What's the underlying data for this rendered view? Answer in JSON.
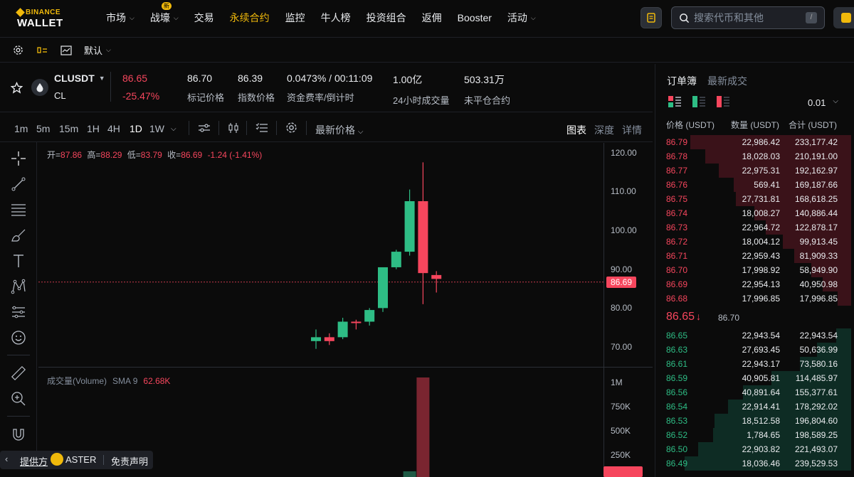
{
  "brand": {
    "top": "BINANCE",
    "bottom": "WALLET"
  },
  "nav": {
    "items": [
      {
        "label": "市场",
        "dropdown": true
      },
      {
        "label": "战壕",
        "dropdown": true,
        "badge": "新"
      },
      {
        "label": "交易"
      },
      {
        "label": "永续合约",
        "active": true
      },
      {
        "label": "监控"
      },
      {
        "label": "牛人榜"
      },
      {
        "label": "投资组合"
      },
      {
        "label": "返佣"
      },
      {
        "label": "Booster"
      },
      {
        "label": "活动",
        "dropdown": true
      }
    ],
    "search_placeholder": "搜索代币和其他",
    "search_shortcut": "/"
  },
  "subbar": {
    "layout_label": "默认"
  },
  "ticker": {
    "symbol": "CLUSDT",
    "sub": "CL",
    "price": "86.65",
    "change": "-25.47%",
    "stats": [
      {
        "value": "86.70",
        "label": "标记价格"
      },
      {
        "value": "86.39",
        "label": "指数价格"
      },
      {
        "value": "0.0473% / 00:11:09",
        "label": "资金费率/倒计时"
      },
      {
        "value": "1.00亿",
        "label": "24小时成交量"
      },
      {
        "value": "503.31万",
        "label": "未平仓合约"
      }
    ]
  },
  "chart_toolbar": {
    "timeframes": [
      "1m",
      "5m",
      "15m",
      "1H",
      "4H",
      "1D",
      "1W"
    ],
    "active_tf": "1D",
    "price_type": "最新价格",
    "tabs": [
      "图表",
      "深度",
      "详情"
    ]
  },
  "ohlc": {
    "open_k": "开=",
    "open": "87.86",
    "high_k": "高=",
    "high": "88.29",
    "low_k": "低=",
    "low": "83.79",
    "close_k": "收=",
    "close": "86.69",
    "change": "-1.24 (-1.41%)"
  },
  "volume": {
    "label": "成交量(Volume)",
    "sma": "SMA 9",
    "value": "62.68K"
  },
  "chart_data": {
    "type": "candlestick",
    "y_ticks": [
      "120.00",
      "110.00",
      "100.00",
      "90.00",
      "80.00",
      "70.00"
    ],
    "ylim": [
      64.7,
      122.5
    ],
    "last_price": "86.69",
    "candles": [
      {
        "o": 71.5,
        "h": 74.5,
        "l": 69.5,
        "c": 72.5
      },
      {
        "o": 72.5,
        "h": 73.5,
        "l": 70.5,
        "c": 71.5
      },
      {
        "o": 72.5,
        "h": 77.5,
        "l": 72.0,
        "c": 76.5
      },
      {
        "o": 76.5,
        "h": 77.0,
        "l": 74.5,
        "c": 76.3
      },
      {
        "o": 76.5,
        "h": 80.0,
        "l": 75.5,
        "c": 79.5
      },
      {
        "o": 80.0,
        "h": 90.0,
        "l": 79.0,
        "c": 90.5
      },
      {
        "o": 90.5,
        "h": 95.0,
        "l": 90.0,
        "c": 94.5
      },
      {
        "o": 94.5,
        "h": 110.5,
        "l": 93.5,
        "c": 107.5
      },
      {
        "o": 107.5,
        "h": 117.5,
        "l": 81.0,
        "c": 89.0
      },
      {
        "o": 88.5,
        "h": 89.5,
        "l": 84.0,
        "c": 87.5
      }
    ],
    "volume_ticks": [
      "1M",
      "750K",
      "500K",
      "250K"
    ],
    "volume_last": "62.68K"
  },
  "orderbook": {
    "tabs": [
      "订单簿",
      "最新成交"
    ],
    "precision": "0.01",
    "headers": [
      "价格 (USDT)",
      "数量 (USDT)",
      "合计 (USDT)"
    ],
    "asks": [
      {
        "price": "86.79",
        "qty": "22,986.42",
        "total": "233,177.42",
        "depth": 0.85
      },
      {
        "price": "86.78",
        "qty": "18,028.03",
        "total": "210,191.00",
        "depth": 0.77
      },
      {
        "price": "86.77",
        "qty": "22,975.31",
        "total": "192,162.97",
        "depth": 0.7
      },
      {
        "price": "86.76",
        "qty": "569.41",
        "total": "169,187.66",
        "depth": 0.62
      },
      {
        "price": "86.75",
        "qty": "27,731.81",
        "total": "168,618.25",
        "depth": 0.61
      },
      {
        "price": "86.74",
        "qty": "18,008.27",
        "total": "140,886.44",
        "depth": 0.51
      },
      {
        "price": "86.73",
        "qty": "22,964.72",
        "total": "122,878.17",
        "depth": 0.45
      },
      {
        "price": "86.72",
        "qty": "18,004.12",
        "total": "99,913.45",
        "depth": 0.36
      },
      {
        "price": "86.71",
        "qty": "22,959.43",
        "total": "81,909.33",
        "depth": 0.3
      },
      {
        "price": "86.70",
        "qty": "17,998.92",
        "total": "58,949.90",
        "depth": 0.21
      },
      {
        "price": "86.69",
        "qty": "22,954.13",
        "total": "40,950.98",
        "depth": 0.15
      },
      {
        "price": "86.68",
        "qty": "17,996.85",
        "total": "17,996.85",
        "depth": 0.07
      }
    ],
    "mid": {
      "price": "86.65",
      "arrow": "↓",
      "mark": "86.70"
    },
    "bids": [
      {
        "price": "86.65",
        "qty": "22,943.54",
        "total": "22,943.54",
        "depth": 0.08
      },
      {
        "price": "86.63",
        "qty": "27,693.45",
        "total": "50,636.99",
        "depth": 0.18
      },
      {
        "price": "86.61",
        "qty": "22,943.17",
        "total": "73,580.16",
        "depth": 0.27
      },
      {
        "price": "86.59",
        "qty": "40,905.81",
        "total": "114,485.97",
        "depth": 0.42
      },
      {
        "price": "86.56",
        "qty": "40,891.64",
        "total": "155,377.61",
        "depth": 0.57
      },
      {
        "price": "86.54",
        "qty": "22,914.41",
        "total": "178,292.02",
        "depth": 0.65
      },
      {
        "price": "86.53",
        "qty": "18,512.58",
        "total": "196,804.60",
        "depth": 0.72
      },
      {
        "price": "86.52",
        "qty": "1,784.65",
        "total": "198,589.25",
        "depth": 0.73
      },
      {
        "price": "86.50",
        "qty": "22,903.82",
        "total": "221,493.07",
        "depth": 0.81
      },
      {
        "price": "86.49",
        "qty": "18,036.46",
        "total": "239,529.53",
        "depth": 0.88
      }
    ]
  },
  "footer": {
    "provider": "提供方",
    "aster": "ASTER",
    "disclaimer": "免责声明"
  },
  "colors": {
    "up": "#2ebd85",
    "down": "#f6465d",
    "accent": "#f0b90b"
  }
}
